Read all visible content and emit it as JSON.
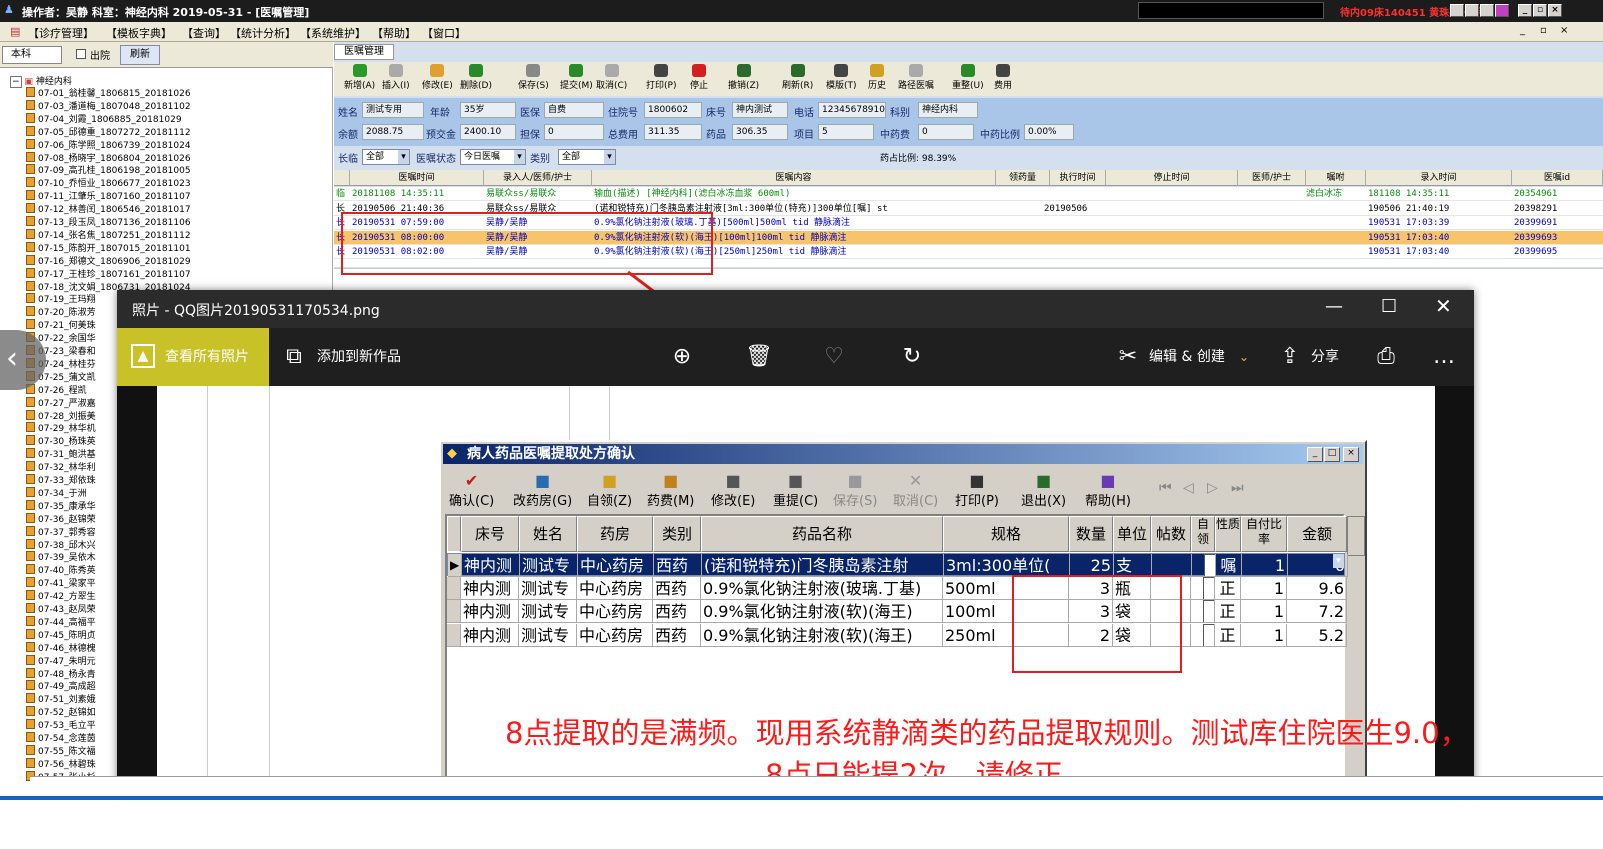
{
  "titlebar": {
    "text": "操作者：吴静  科室：神经内科  2019-05-31 - [医嘱管理]",
    "right_text": "待内09床140451 黄珠英 一手"
  },
  "menu": [
    "【诊疗管理】",
    "【模板字典】",
    "【查询】",
    "【统计分析】",
    "【系统维护】",
    "【帮助】",
    "【窗口】"
  ],
  "left": {
    "tabs": [
      "本科",
      "出院",
      "刷新"
    ],
    "root": "神经内科",
    "patients": [
      "07-01_翁桂馨_1806815_20181026",
      "07-03_潘道梅_1807048_20181102",
      "07-04_刘霞_1806885_20181029",
      "07-05_邱德重_1807272_20181112",
      "07-06_陈学照_1806739_20181024",
      "07-08_杨晓宇_1806804_20181026",
      "07-09_高孔桂_1806198_20181005",
      "07-10_乔恒业_1806677_20181023",
      "07-11_江肇乐_1807160_20181107",
      "07-12_林善闰_1806546_20181017",
      "07-13_段玉凤_1807136_20181106",
      "07-14_张名焦_1807251_20181112",
      "07-15_陈韵开_1807015_20181101",
      "07-16_郑德文_1806906_20181029",
      "07-17_王桂珍_1807161_20181107",
      "07-18_沈文娟_1806731_20181024",
      "07-19_王玛翔",
      "07-20_陈淑芳",
      "07-21_何美珠",
      "07-22_余国华",
      "07-23_梁春和",
      "07-24_林桂芬",
      "07-25_蒲文凯",
      "07-26_程凯",
      "07-27_严淑嘉",
      "07-28_刘振美",
      "07-29_林华机",
      "07-30_杨珠英",
      "07-31_鲍洪基",
      "07-32_林华利",
      "07-33_郑依珠",
      "07-34_于洲",
      "07-35_康承华",
      "07-36_赵锦荣",
      "07-37_郭秀容",
      "07-38_邱木兴",
      "07-39_吴依木",
      "07-40_陈秀英",
      "07-41_梁家平",
      "07-42_方翠生",
      "07-43_赵凤荣",
      "07-44_高福平",
      "07-45_陈明贞",
      "07-46_林德槐",
      "07-47_朱明元",
      "07-48_杨永青",
      "07-49_高成超",
      "07-51_刘素娥",
      "07-52_赵锦如",
      "07-53_毛立平",
      "07-54_念莲茵",
      "07-55_陈文福",
      "07-56_林碧珠",
      "07-57_张小杉"
    ]
  },
  "right": {
    "tab": "医嘱管理",
    "toolbar": [
      "新增(A)",
      "插入(I)",
      "修改(E)",
      "删除(D)",
      "保存(S)",
      "提交(M)",
      "取消(C)",
      "打印(P)",
      "停止",
      "撤销(Z)",
      "刷新(R)",
      "模版(T)",
      "历史",
      "路径医嘱",
      "重整(U)",
      "费用"
    ],
    "info": [
      {
        "label": "姓名",
        "value": "测试专用"
      },
      {
        "label": "年龄",
        "value": "35岁"
      },
      {
        "label": "医保",
        "value": "自费"
      },
      {
        "label": "住院号",
        "value": "1800602"
      },
      {
        "label": "床号",
        "value": "神内测试"
      },
      {
        "label": "电话",
        "value": "12345678910"
      },
      {
        "label": "科别",
        "value": "神经内科"
      },
      {
        "label": "余额",
        "value": "2088.75"
      },
      {
        "label": "预交金",
        "value": "2400.10"
      },
      {
        "label": "担保",
        "value": "0"
      },
      {
        "label": "总费用",
        "value": "311.35"
      },
      {
        "label": "药品",
        "value": "306.35"
      },
      {
        "label": "项目",
        "value": "5"
      },
      {
        "label": "中药费",
        "value": "0"
      },
      {
        "label": "中药比例",
        "value": "0.00%"
      }
    ],
    "filter": {
      "l1": "长临",
      "v1": "全部",
      "l2": "医嘱状态",
      "v2": "今日医嘱",
      "l3": "类别",
      "v3": "全部",
      "ratio": "药占比例: 98.39%"
    },
    "grid_headers": [
      "",
      "医嘱时间",
      "录入人/医师/护士",
      "医嘱内容",
      "领药量",
      "执行时间",
      "停止时间",
      "医师/护士",
      "嘱咐",
      "录入时间",
      "医嘱id"
    ],
    "grid_rows": [
      {
        "type": "临",
        "time": "20181108 14:35:11",
        "who": "易联众ss/易联众",
        "content": "输血(描述)  [神经内科](滤白冰冻血浆 600ml)",
        "exec": "",
        "stop": "",
        "note": "滤白冰冻",
        "entry": "181108 14:35:11",
        "id": "20354961",
        "color": "#0a8a0a"
      },
      {
        "type": "长",
        "time": "20190506 21:40:36",
        "who": "易联众ss/易联众",
        "content": "(诺和锐特充)门冬胰岛素注射液[3ml:300单位(特充)]300单位[嘱] st",
        "exec": "20190506",
        "stop": "",
        "note": "",
        "entry": "190506 21:40:19",
        "id": "20398291",
        "color": "#000"
      },
      {
        "type": "长",
        "time": "20190531 07:59:00",
        "who": "吴静/吴静",
        "content": "0.9%氯化钠注射液(玻璃.丁基)[500ml]500ml tid 静脉滴注",
        "exec": "",
        "stop": "",
        "note": "",
        "entry": "190531 17:03:39",
        "id": "20399691",
        "color": "#0000c0"
      },
      {
        "type": "长",
        "time": "20190531 08:00:00",
        "who": "吴静/吴静",
        "content": "0.9%氯化钠注射液(软)(海王)[100ml]100ml tid 静脉滴注",
        "exec": "",
        "stop": "",
        "note": "",
        "entry": "190531 17:03:40",
        "id": "20399693",
        "color": "#0000c0",
        "selected": true
      },
      {
        "type": "长",
        "time": "20190531 08:02:00",
        "who": "吴静/吴静",
        "content": "0.9%氯化钠注射液(软)(海王)[250ml]250ml tid 静脉滴注",
        "exec": "",
        "stop": "",
        "note": "",
        "entry": "190531 17:03:40",
        "id": "20399695",
        "color": "#0000c0"
      }
    ]
  },
  "photo": {
    "title": "照片 - QQ图片20190531170534.png",
    "view_all": "查看所有照片",
    "add_new": "添加到新作品",
    "edit": "编辑 & 创建",
    "share": "分享"
  },
  "dialog": {
    "title": "病人药品医嘱提取处方确认",
    "toolbar": [
      "确认(C)",
      "改药房(G)",
      "自领(Z)",
      "药费(M)",
      "修改(E)",
      "重提(C)",
      "保存(S)",
      "取消(C)",
      "打印(P)",
      "退出(X)",
      "帮助(H)"
    ],
    "headers": [
      "床号",
      "姓名",
      "药房",
      "类别",
      "药品名称",
      "规格",
      "数量",
      "单位",
      "帖数",
      "自领",
      "性质",
      "自付比率",
      "金额"
    ],
    "rows": [
      {
        "bed": "神内测",
        "name": "测试专",
        "pharm": "中心药房",
        "cat": "西药",
        "drug": "(诺和锐特充)门冬胰岛素注射",
        "spec": "3ml:300单位(",
        "qty": "25",
        "unit": "支",
        "tie": "",
        "nature": "嘱",
        "ratio": "1",
        "amount": "0",
        "selected": true
      },
      {
        "bed": "神内测",
        "name": "测试专",
        "pharm": "中心药房",
        "cat": "西药",
        "drug": "0.9%氯化钠注射液(玻璃.丁基)",
        "spec": "500ml",
        "qty": "3",
        "unit": "瓶",
        "tie": "",
        "nature": "正",
        "ratio": "1",
        "amount": "9.6"
      },
      {
        "bed": "神内测",
        "name": "测试专",
        "pharm": "中心药房",
        "cat": "西药",
        "drug": "0.9%氯化钠注射液(软)(海王)",
        "spec": "100ml",
        "qty": "3",
        "unit": "袋",
        "tie": "",
        "nature": "正",
        "ratio": "1",
        "amount": "7.2"
      },
      {
        "bed": "神内测",
        "name": "测试专",
        "pharm": "中心药房",
        "cat": "西药",
        "drug": "0.9%氯化钠注射液(软)(海王)",
        "spec": "250ml",
        "qty": "2",
        "unit": "袋",
        "tie": "",
        "nature": "正",
        "ratio": "1",
        "amount": "5.2"
      }
    ]
  },
  "annotation": {
    "line1": "8点提取的是满频。现用系统静滴类的药品提取规则。测试库住院医生9.0，",
    "line2": "8点只能提2次。请修正。"
  }
}
